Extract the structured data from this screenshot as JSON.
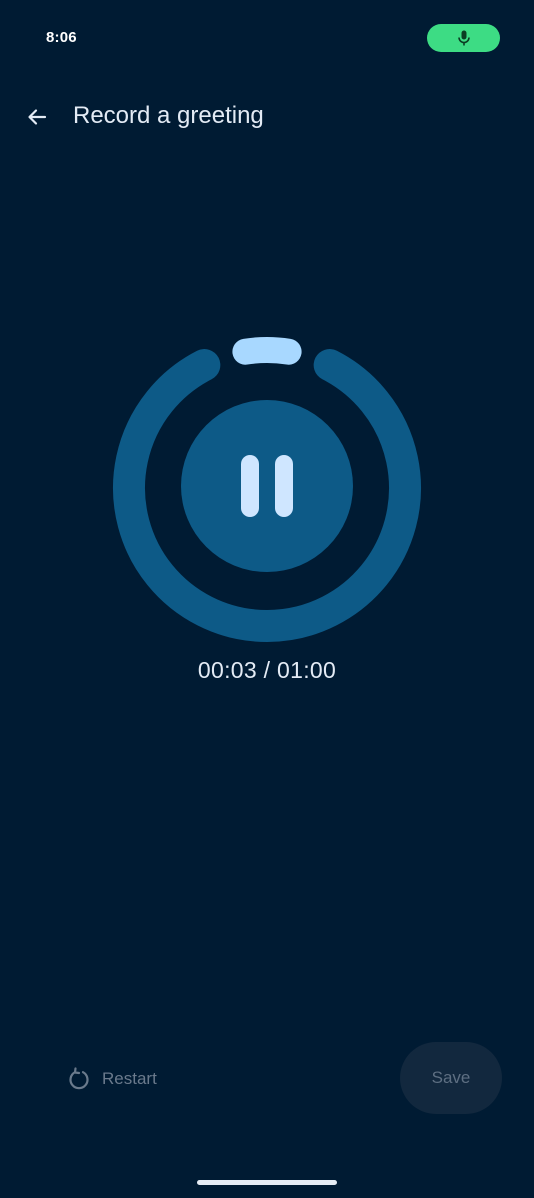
{
  "status_bar": {
    "time": "8:06",
    "mic_icon": "mic-icon",
    "mic_pill_color": "#3ddc84"
  },
  "app_bar": {
    "back_icon": "arrow-back-icon",
    "title": "Record a greeting"
  },
  "recorder": {
    "state_icon": "pause-icon",
    "elapsed": "00:03",
    "separator": " / ",
    "total": "01:00",
    "progress_fraction": 0.05,
    "ring_color": "#0d5a87",
    "progress_color": "#a8d8ff"
  },
  "actions": {
    "restart_icon": "restart-icon",
    "restart_label": "Restart",
    "save_label": "Save"
  }
}
